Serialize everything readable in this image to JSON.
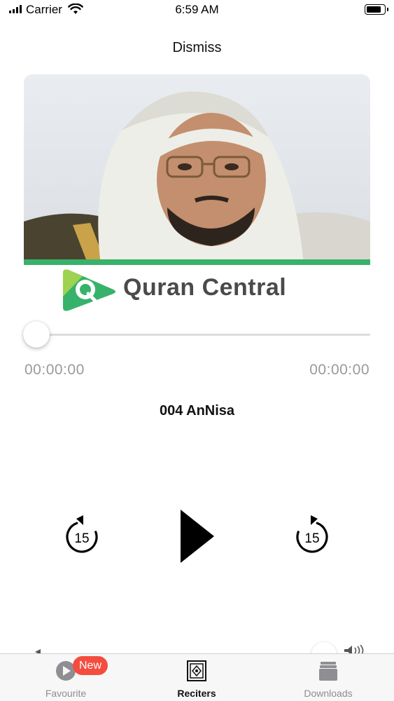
{
  "status_bar": {
    "carrier": "Carrier",
    "time": "6:59 AM",
    "battery_level": 0.8
  },
  "header": {
    "dismiss_label": "Dismiss"
  },
  "artwork": {
    "logo_text": "Quran Central",
    "brand_color": "#38b26a"
  },
  "player": {
    "progress": 0,
    "elapsed": "00:00:00",
    "remaining": "00:00:00",
    "track_title": "004 AnNisa",
    "skip_back_seconds": "15",
    "skip_forward_seconds": "15",
    "state": "paused"
  },
  "tab_bar": {
    "items": [
      {
        "label": "Favourite",
        "icon": "play-circle-icon",
        "badge": "New",
        "active": false
      },
      {
        "label": "Reciters",
        "icon": "quran-book-icon",
        "active": true
      },
      {
        "label": "Downloads",
        "icon": "stack-icon",
        "active": false
      }
    ]
  }
}
